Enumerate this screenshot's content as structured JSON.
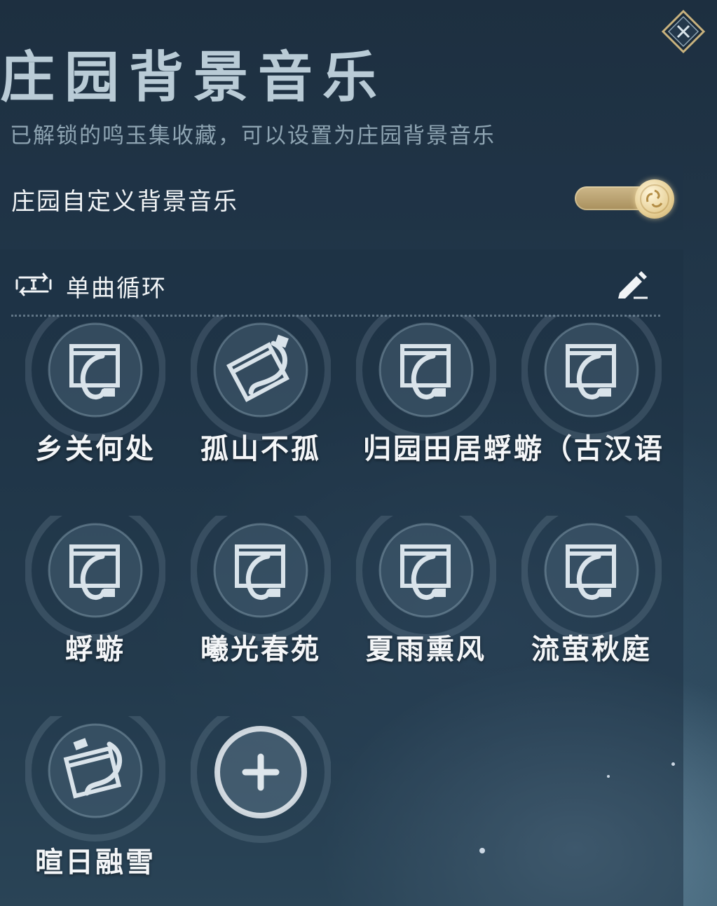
{
  "header": {
    "title": "庄园背景音乐",
    "subtitle": "已解锁的鸣玉集收藏，可以设置为庄园背景音乐",
    "close_icon": "close-icon"
  },
  "custom_music": {
    "label": "庄园自定义背景音乐",
    "enabled": true
  },
  "playback": {
    "mode_label": "单曲循环",
    "mode_icon": "repeat-one-icon",
    "edit_icon": "pencil-icon"
  },
  "tracks": [
    {
      "title": "乡关何处",
      "icon": "scroll-brush-icon"
    },
    {
      "title": "孤山不孤",
      "icon": "tilted-scroll-brush-icon"
    },
    {
      "title": "归园田居蜉蝣（古汉语",
      "icon": "scroll-brush-icon"
    },
    {
      "title": "",
      "icon": "scroll-brush-icon"
    },
    {
      "title": "蜉蝣",
      "icon": "scroll-brush-icon"
    },
    {
      "title": "曦光春苑",
      "icon": "scroll-brush-icon"
    },
    {
      "title": "夏雨熏风",
      "icon": "scroll-brush-icon"
    },
    {
      "title": "流萤秋庭",
      "icon": "scroll-brush-icon"
    },
    {
      "title": "暄日融雪",
      "icon": "tilted-scroll-brush-icon"
    }
  ],
  "add_track": {
    "icon": "plus-icon"
  },
  "colors": {
    "accent_gold": "#d8c28c",
    "panel": "#20344a"
  }
}
